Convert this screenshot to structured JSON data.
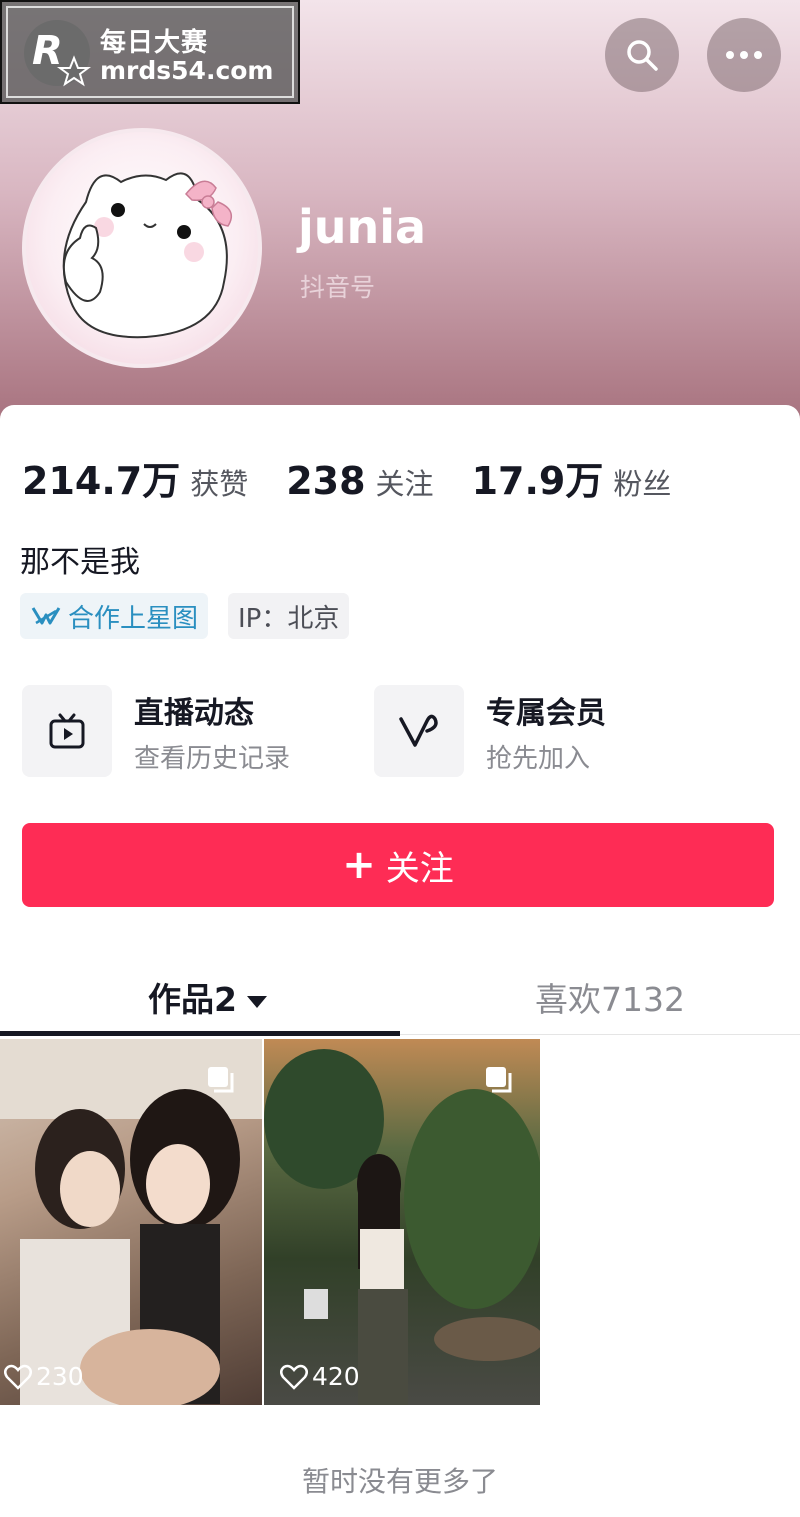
{
  "watermark": {
    "title": "每日大赛",
    "url": "mrds54.com",
    "logo_letter": "R"
  },
  "header": {
    "username": "junia",
    "douyin_id_label": "抖音号",
    "actions": {
      "search_icon": "search-icon",
      "more_icon": "more-icon"
    }
  },
  "stats": [
    {
      "value": "214.7万",
      "label": "获赞"
    },
    {
      "value": "238",
      "label": "关注"
    },
    {
      "value": "17.9万",
      "label": "粉丝"
    }
  ],
  "bio": "那不是我",
  "tags": {
    "xingtu": "合作上星图",
    "ip": "IP：北京"
  },
  "services": [
    {
      "title": "直播动态",
      "subtitle": "查看历史记录",
      "icon": "tv-icon"
    },
    {
      "title": "专属会员",
      "subtitle": "抢先加入",
      "icon": "v-heart-icon"
    }
  ],
  "follow_button": {
    "plus": "+",
    "label": "关注"
  },
  "tabs": [
    {
      "label": "作品2",
      "active": true
    },
    {
      "label": "喜欢7132",
      "active": false
    }
  ],
  "videos": [
    {
      "likes": "230"
    },
    {
      "likes": "420"
    }
  ],
  "end_text": "暂时没有更多了",
  "colors": {
    "accent": "#fe2c55",
    "tag_blue": "#2a8fc0"
  }
}
